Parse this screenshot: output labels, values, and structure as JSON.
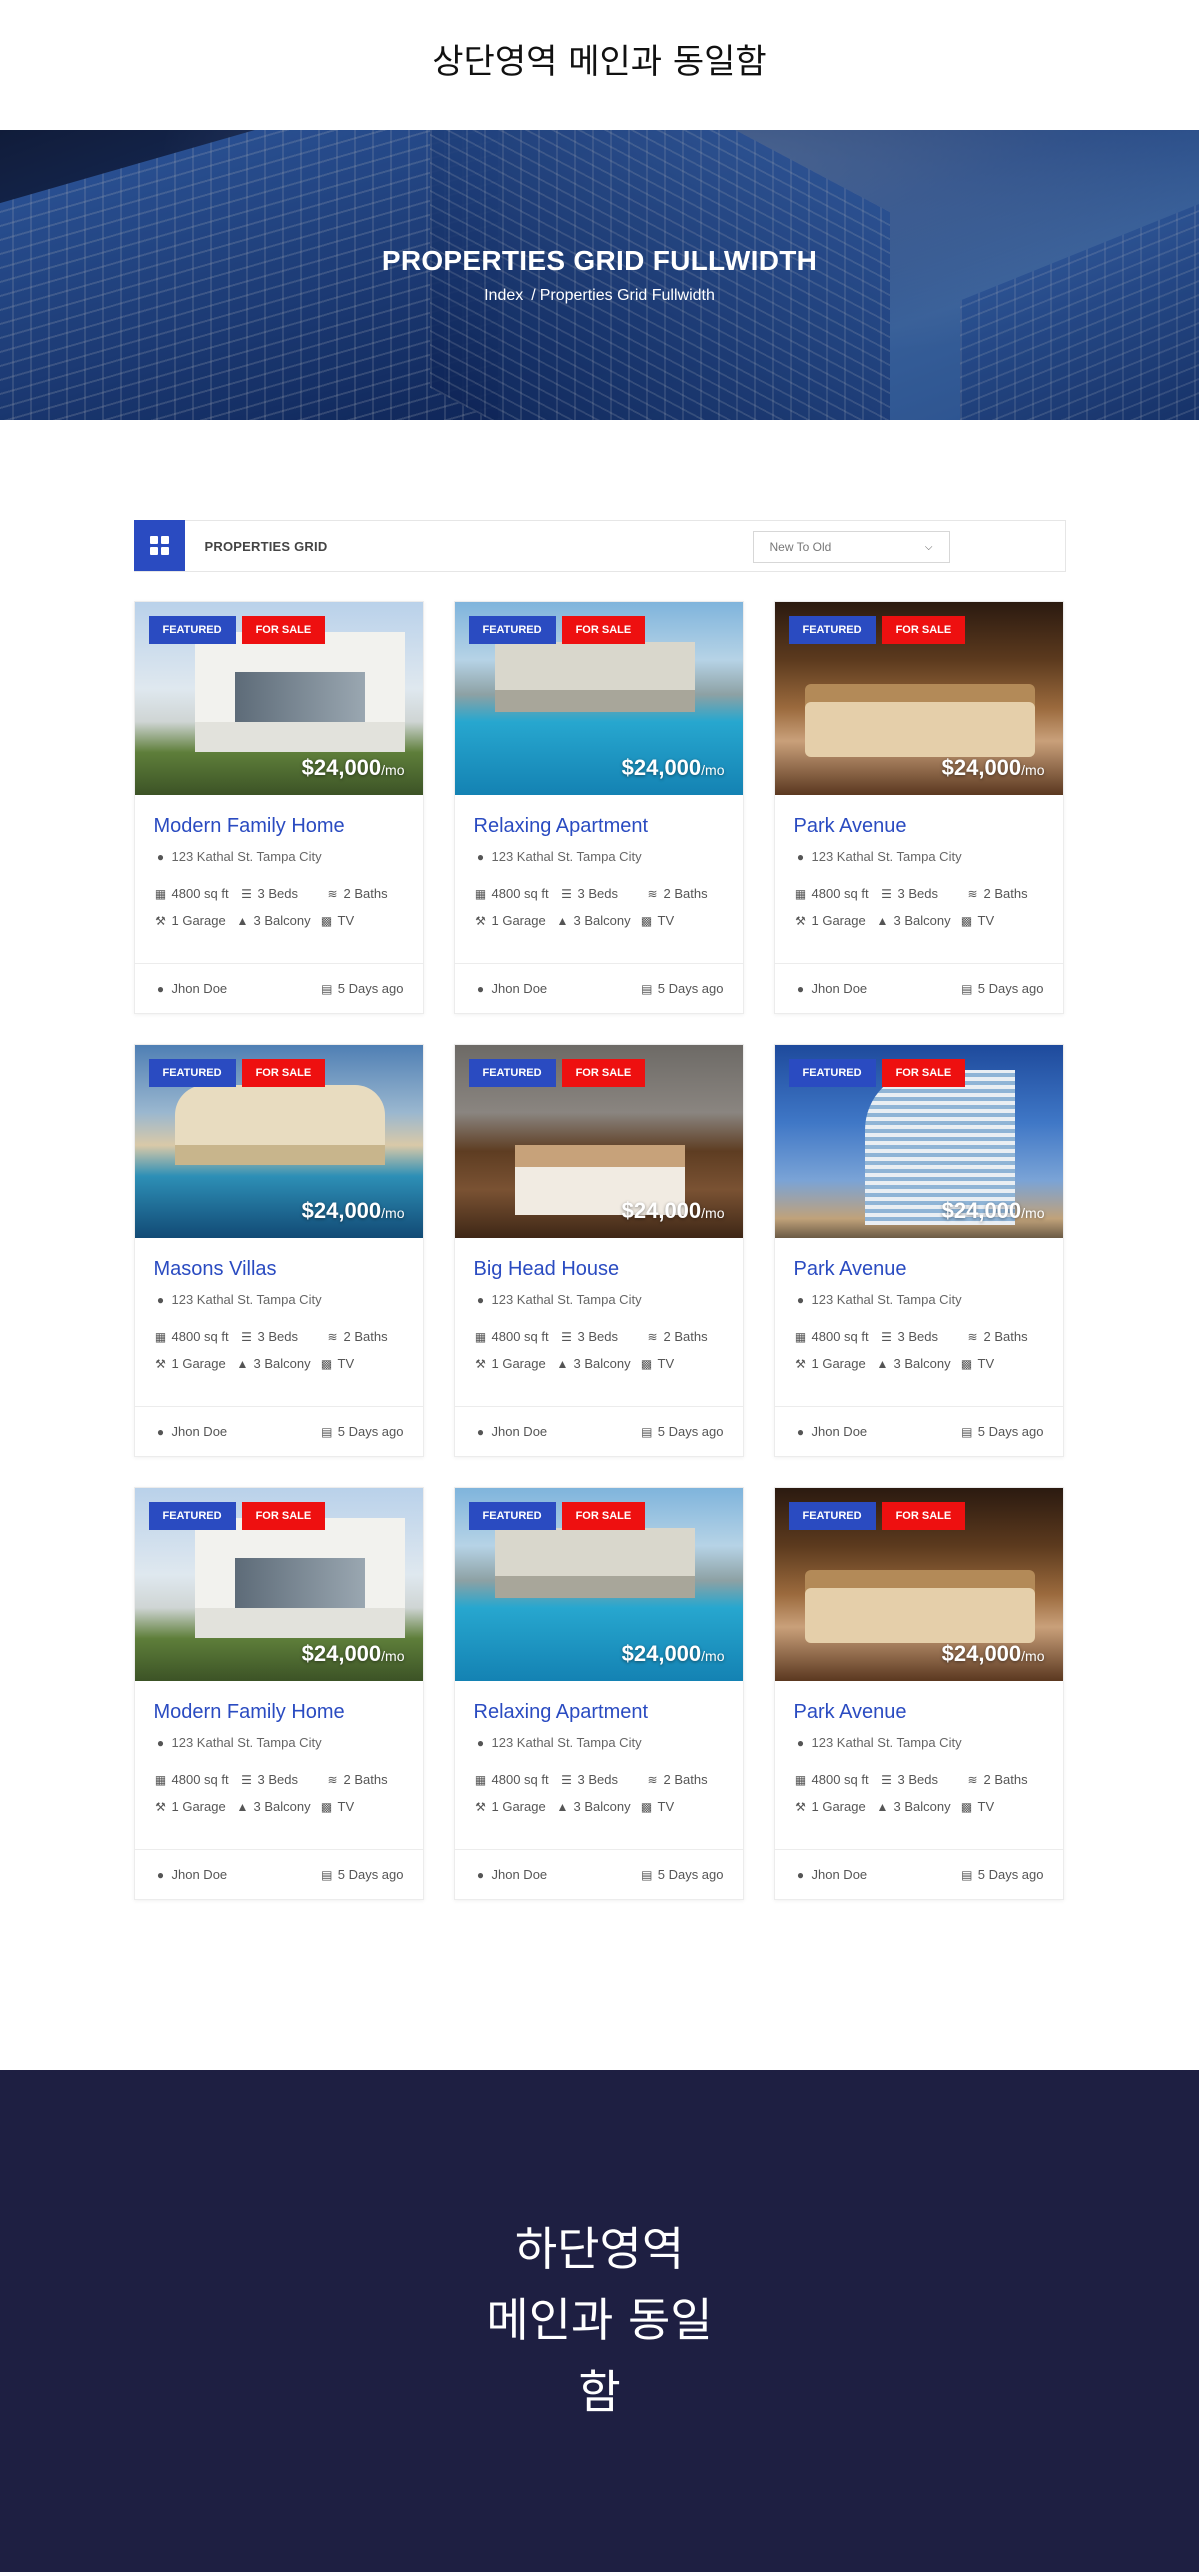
{
  "header": {
    "text": "상단영역 메인과 동일함"
  },
  "hero": {
    "title": "PROPERTIES GRID FULLWIDTH",
    "breadcrumb": {
      "home": "Index",
      "separator": "/",
      "current": "Properties Grid Fullwidth"
    }
  },
  "toolbar": {
    "view_icon": "grid-icon",
    "label": "PROPERTIES GRID",
    "sort": {
      "selected": "New To Old"
    }
  },
  "common": {
    "featured": "FEATURED",
    "for_sale": "FOR SALE",
    "price": "$24,000",
    "price_unit": "/mo",
    "address": "123 Kathal St. Tampa City",
    "area": "4800 sq ft",
    "beds": "3 Beds",
    "baths": "2 Baths",
    "garage": "1 Garage",
    "balcony": "3 Balcony",
    "tv": "TV",
    "agent": "Jhon Doe",
    "posted": "5 Days ago"
  },
  "colors": {
    "accent": "#2a4bc1",
    "sale": "#ee1010",
    "footer_bg": "#1e1f42"
  },
  "properties": [
    {
      "title": "Modern Family Home"
    },
    {
      "title": "Relaxing Apartment"
    },
    {
      "title": "Park Avenue"
    },
    {
      "title": "Masons Villas"
    },
    {
      "title": "Big Head House"
    },
    {
      "title": "Park Avenue"
    },
    {
      "title": "Modern Family Home"
    },
    {
      "title": "Relaxing Apartment"
    },
    {
      "title": "Park Avenue"
    }
  ],
  "footer": {
    "line1": "하단영역",
    "line2": "메인과 동일함"
  }
}
